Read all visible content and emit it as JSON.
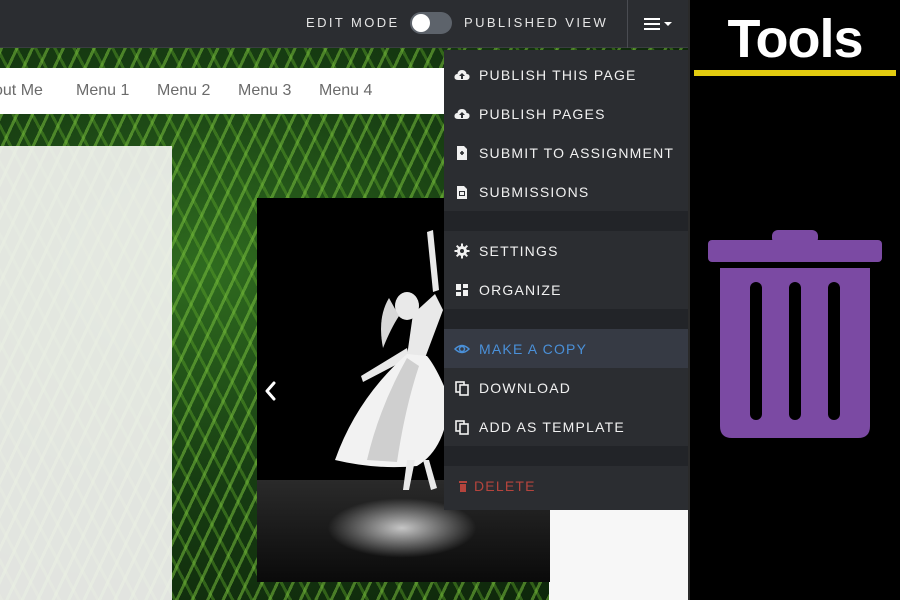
{
  "topbar": {
    "edit_mode_label": "EDIT MODE",
    "published_view_label": "PUBLISHED VIEW",
    "menu_icon": "hamburger-menu-icon"
  },
  "nav": {
    "items": [
      "out Me",
      "Menu 1",
      "Menu 2",
      "Menu 3",
      "Menu 4"
    ]
  },
  "slideshow": {
    "prev_icon": "chevron-left-icon"
  },
  "dropdown": {
    "items": [
      {
        "label": "PUBLISH THIS PAGE",
        "icon": "cloud-upload-icon"
      },
      {
        "label": "PUBLISH PAGES",
        "icon": "cloud-upload-icon"
      },
      {
        "label": "SUBMIT TO ASSIGNMENT",
        "icon": "file-submit-icon"
      },
      {
        "label": "SUBMISSIONS",
        "icon": "files-icon"
      },
      {
        "label": "SETTINGS",
        "icon": "gear-icon"
      },
      {
        "label": "ORGANIZE",
        "icon": "grid-icon"
      },
      {
        "label": "MAKE A COPY",
        "icon": "eye-copy-icon"
      },
      {
        "label": "DOWNLOAD",
        "icon": "copy-icon"
      },
      {
        "label": "ADD AS TEMPLATE",
        "icon": "copy-icon"
      },
      {
        "label": "DELETE",
        "icon": "trash-icon"
      }
    ],
    "active_item": "MAKE A COPY"
  },
  "tools": {
    "title": "Tools",
    "icon": "trash-icon"
  },
  "colors": {
    "accent_blue": "#4a90d9",
    "danger_red": "#b5443d",
    "tools_underline": "#e2cc10",
    "trash_purple": "#7b4aa3"
  }
}
